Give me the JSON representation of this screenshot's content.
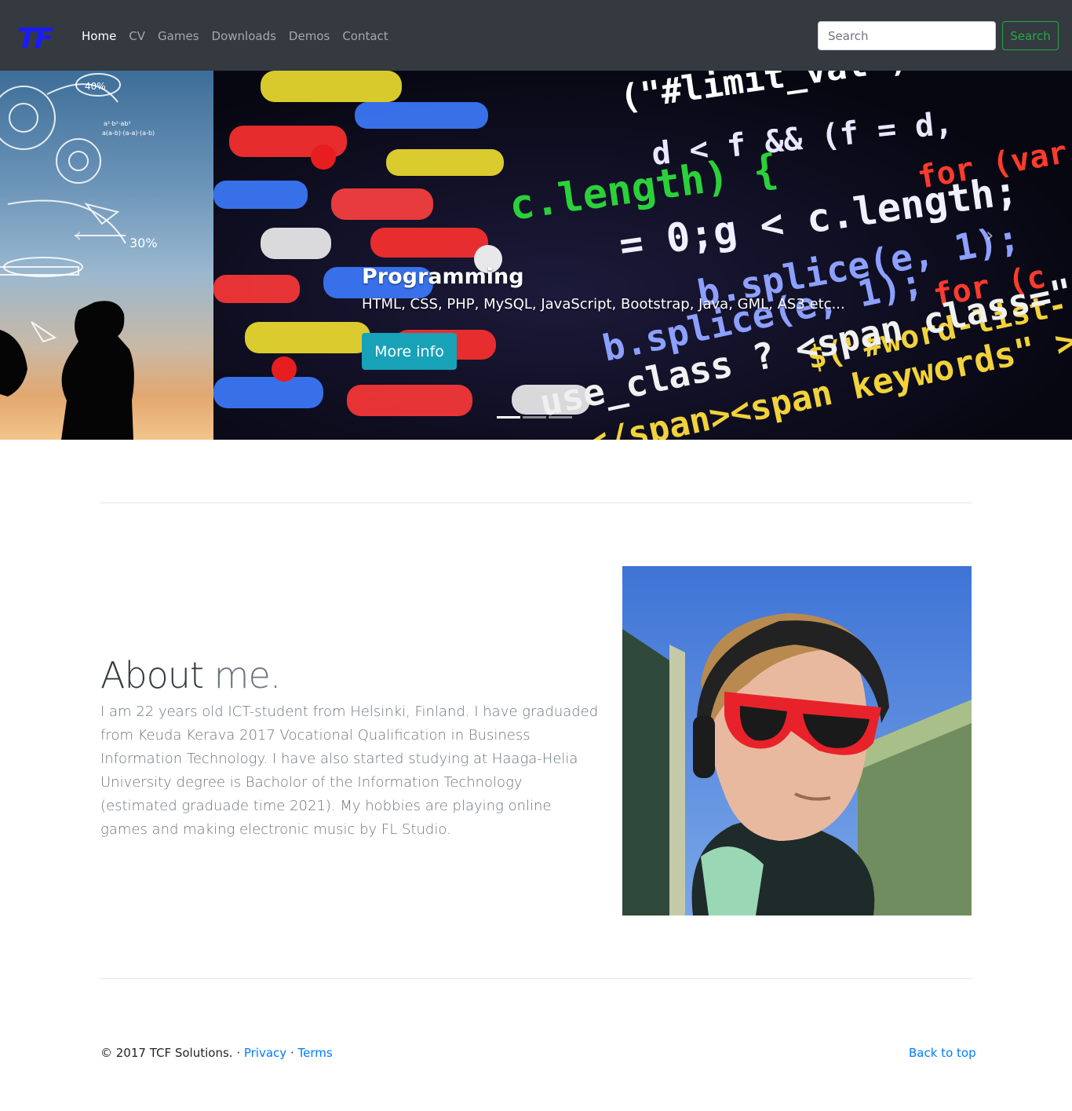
{
  "navbar": {
    "brand": "TF",
    "links": [
      "Home",
      "CV",
      "Games",
      "Downloads",
      "Demos",
      "Contact"
    ],
    "active_link": "Home",
    "search_placeholder": "Search",
    "search_button": "Search"
  },
  "carousel": {
    "caption_title": "Programming",
    "caption_text": "HTML, CSS, PHP, MySQL, JavaScript, Bootstrap, Java, GML, AS3 etc...",
    "button_label": "More info",
    "prev_icon": "‹",
    "next_icon": "›",
    "slides_count": 3,
    "active_slide": 1
  },
  "about": {
    "heading_main": "About",
    "heading_muted": "me.",
    "text": "I am 22 years old ICT-student from Helsinki, Finland. I have graduaded from Keuda Kerava 2017 Vocational Qualification in Business Information Technology. I have also started studying at Haaga-Helia University degree is Bacholor of the Information Technology (estimated graduade time 2021). My hobbies are playing online games and making electronic music by FL Studio."
  },
  "footer": {
    "copyright": "© 2017 TCF Solutions. · ",
    "privacy": "Privacy",
    "separator": " · ",
    "terms": "Terms",
    "back_to_top": "Back to top"
  },
  "colors": {
    "navbar_bg": "#343a40",
    "brand": "#1a1aff",
    "search_button": "#28a745",
    "more_info_button": "#17a2b8",
    "link": "#007bff"
  }
}
